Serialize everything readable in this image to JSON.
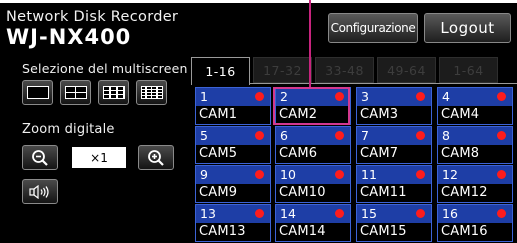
{
  "header": {
    "title": "Network Disk Recorder",
    "model": "WJ-NX400",
    "config_label": "Configurazione",
    "logout_label": "Logout"
  },
  "sidebar": {
    "multiscreen_label": "Selezione del multiscreen",
    "layout_buttons": [
      "layout-1-icon",
      "layout-4-icon",
      "layout-9-icon",
      "layout-16-icon"
    ],
    "zoom_label": "Zoom digitale",
    "zoom_out_icon": "zoom-out-icon",
    "zoom_value": "×1",
    "zoom_in_icon": "zoom-in-icon",
    "audio_icon": "speaker-icon"
  },
  "tabs": [
    {
      "label": "1-16",
      "active": true
    },
    {
      "label": "17-32",
      "active": false
    },
    {
      "label": "33-48",
      "active": false
    },
    {
      "label": "49-64",
      "active": false
    },
    {
      "label": "1-64",
      "active": false
    }
  ],
  "cameras": [
    {
      "num": "1",
      "name": "CAM1"
    },
    {
      "num": "2",
      "name": "CAM2"
    },
    {
      "num": "3",
      "name": "CAM3"
    },
    {
      "num": "4",
      "name": "CAM4"
    },
    {
      "num": "5",
      "name": "CAM5"
    },
    {
      "num": "6",
      "name": "CAM6"
    },
    {
      "num": "7",
      "name": "CAM7"
    },
    {
      "num": "8",
      "name": "CAM8"
    },
    {
      "num": "9",
      "name": "CAM9"
    },
    {
      "num": "10",
      "name": "CAM10"
    },
    {
      "num": "11",
      "name": "CAM11"
    },
    {
      "num": "12",
      "name": "CAM12"
    },
    {
      "num": "13",
      "name": "CAM13"
    },
    {
      "num": "14",
      "name": "CAM14"
    },
    {
      "num": "15",
      "name": "CAM15"
    },
    {
      "num": "16",
      "name": "CAM16"
    }
  ],
  "colors": {
    "tile_blue": "#1e3ea6",
    "rec_dot": "#ff1c1c",
    "highlight": "#d3388f"
  }
}
